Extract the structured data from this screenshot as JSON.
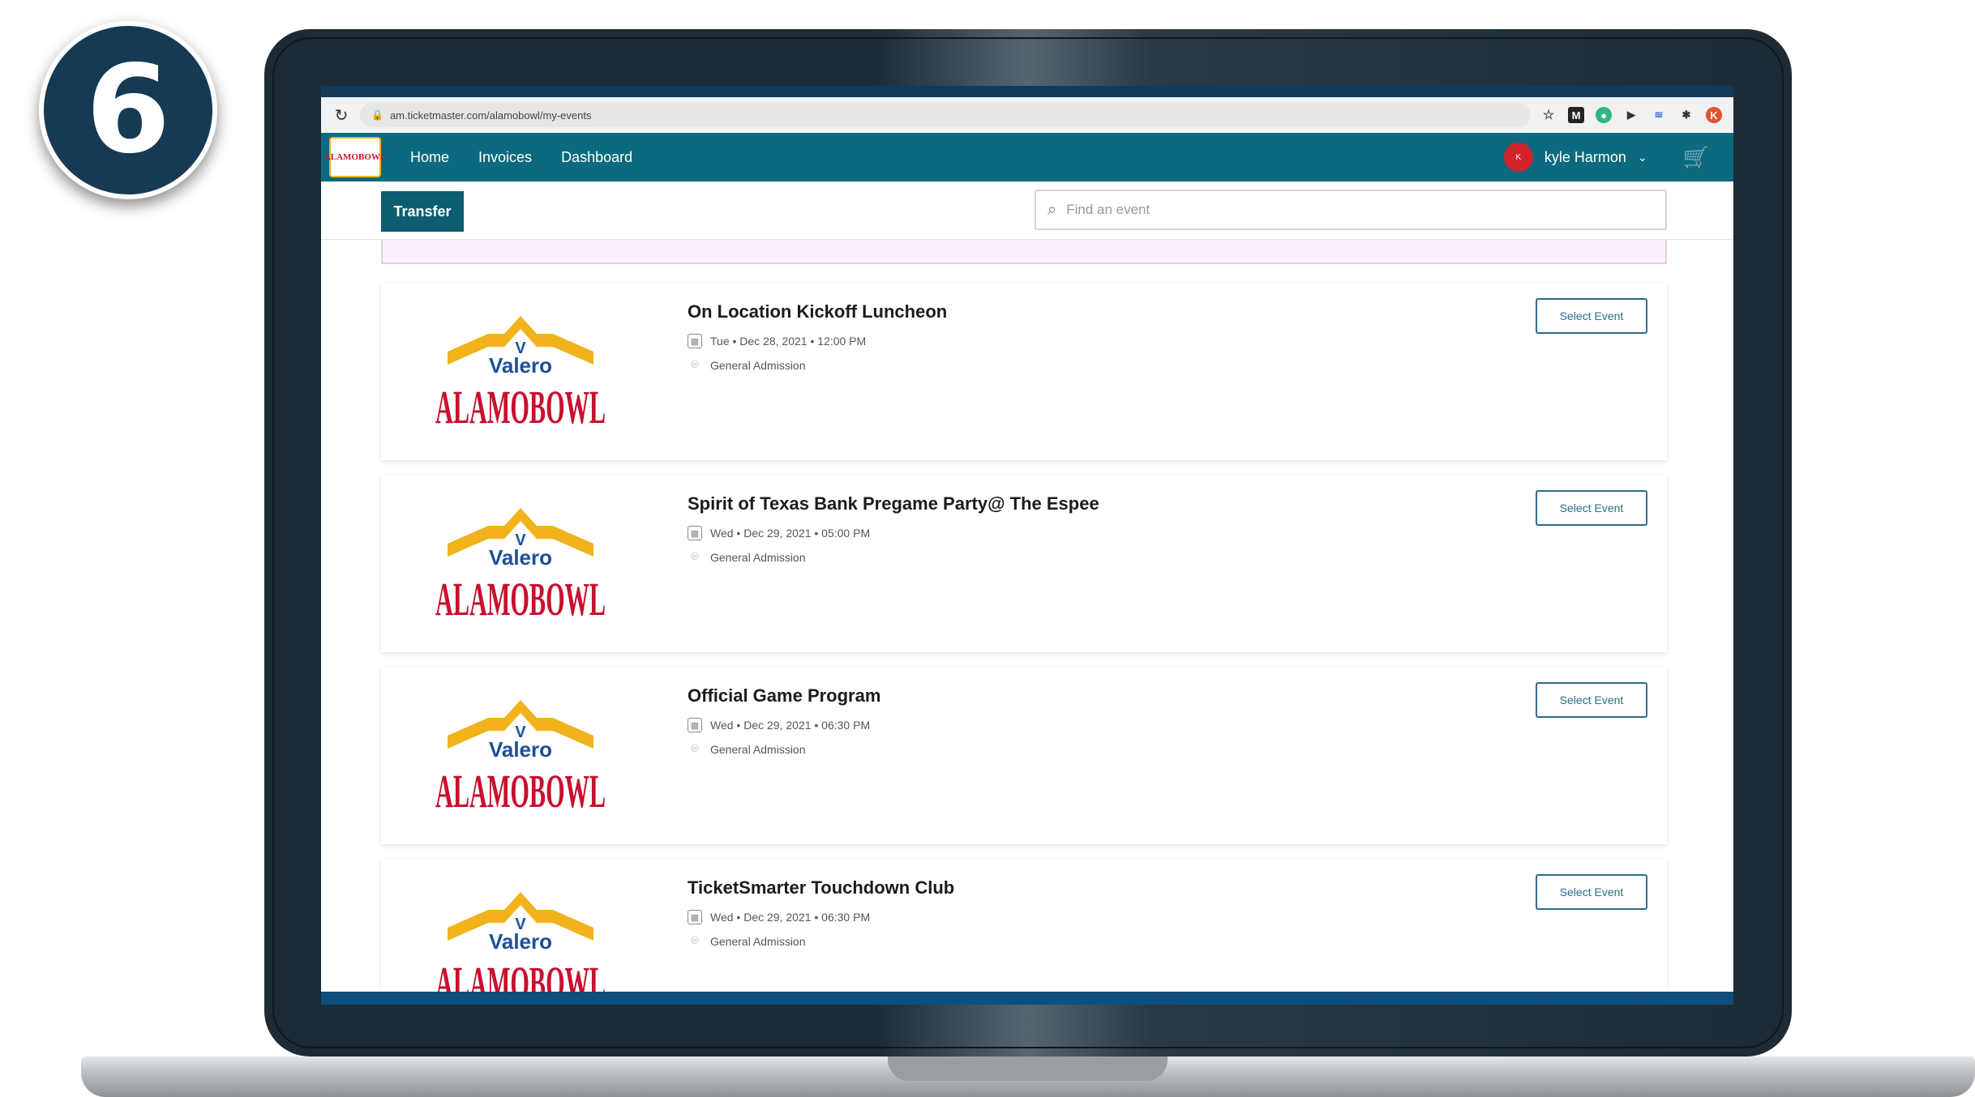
{
  "step_number": "6",
  "browser": {
    "url": "am.ticketmaster.com/alamobowl/my-events"
  },
  "header": {
    "logo_text": "ALAMOBOWL",
    "nav": [
      "Home",
      "Invoices",
      "Dashboard"
    ],
    "user_name": "kyle Harmon",
    "avatar_initial": "K"
  },
  "toolbar": {
    "transfer_label": "Transfer",
    "search_placeholder": "Find an event"
  },
  "events": [
    {
      "title": "On Location Kickoff Luncheon",
      "date": "Tue • Dec 28, 2021 • 12:00 PM",
      "location": "General Admission",
      "button": "Select Event"
    },
    {
      "title": "Spirit of Texas Bank Pregame Party@ The Espee",
      "date": "Wed • Dec 29, 2021 • 05:00 PM",
      "location": "General Admission",
      "button": "Select Event"
    },
    {
      "title": "Official Game Program",
      "date": "Wed • Dec 29, 2021 • 06:30 PM",
      "location": "General Admission",
      "button": "Select Event"
    },
    {
      "title": "TicketSmarter Touchdown Club",
      "date": "Wed • Dec 29, 2021 • 06:30 PM",
      "location": "General Admission",
      "button": "Select Event"
    }
  ],
  "logo": {
    "brand": "Valero",
    "name": "ALAMOBOWL"
  },
  "colors": {
    "header": "#0c6a7e",
    "transfer": "#0c5d6e",
    "badge": "#163a54",
    "logo_red": "#c8102e",
    "logo_yellow": "#f2b21b",
    "logo_blue": "#1c4f9c"
  }
}
